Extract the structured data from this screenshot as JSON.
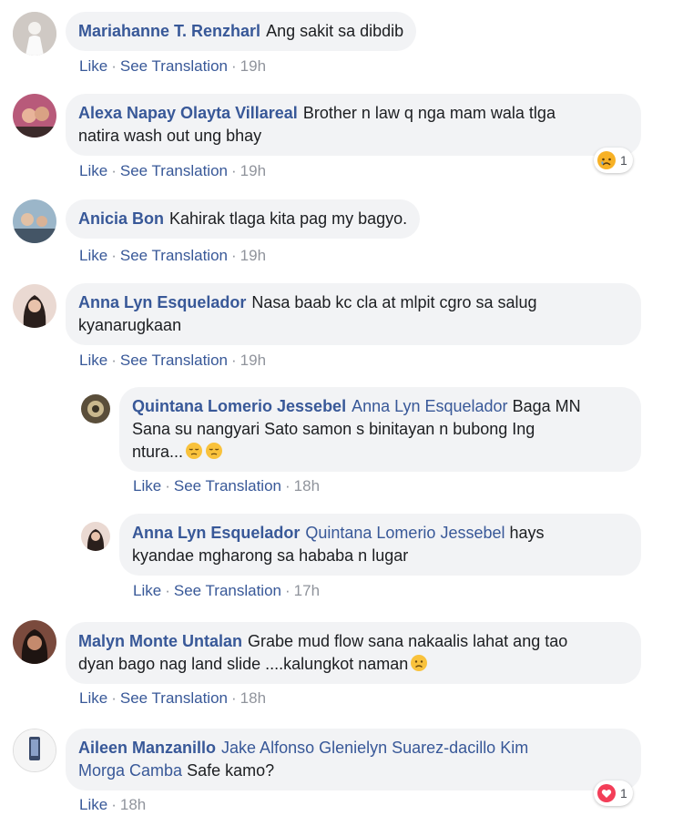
{
  "comments": [
    {
      "name": "Mariahanne T. Renzharl",
      "text": "Ang sakit sa dibdib",
      "like": "Like",
      "translate": "See Translation",
      "time": "19h"
    },
    {
      "name": "Alexa Napay Olayta Villareal",
      "text_line1": "Brother n law q nga mam wala tlga",
      "text_line2": "natira wash out ung bhay",
      "like": "Like",
      "translate": "See Translation",
      "time": "19h",
      "reaction_count": "1",
      "reaction_icon": "sad-face-icon"
    },
    {
      "name": "Anicia Bon",
      "text": "Kahirak tlaga kita pag my bagyo.",
      "like": "Like",
      "translate": "See Translation",
      "time": "19h"
    },
    {
      "name": "Anna Lyn Esquelador",
      "text_line1": "Nasa baab kc cla at mlpit cgro sa salug",
      "text_line2": "kyanarugkaan",
      "like": "Like",
      "translate": "See Translation",
      "time": "19h"
    },
    {
      "name": "Quintana Lomerio Jessebel",
      "mention": "Anna Lyn Esquelador",
      "text_line1_rest": "Baga MN",
      "text_line2": "Sana su nangyari Sato samon s binitayan n bubong Ing",
      "text_line3": "ntura...",
      "like": "Like",
      "translate": "See Translation",
      "time": "18h"
    },
    {
      "name": "Anna Lyn Esquelador",
      "mention": "Quintana Lomerio Jessebel",
      "text_line1_rest": "hays",
      "text_line2": "kyandae mgharong sa hababa n lugar",
      "like": "Like",
      "translate": "See Translation",
      "time": "17h"
    },
    {
      "name": "Malyn Monte Untalan",
      "text_line1": "Grabe mud flow sana nakaalis lahat ang tao",
      "text_line2": "dyan bago nag land slide ....kalungkot naman",
      "like": "Like",
      "translate": "See Translation",
      "time": "18h"
    },
    {
      "name": "Aileen Manzanillo",
      "mention_line1": "Jake Alfonso Glenielyn Suarez-dacillo Kim",
      "mention_line2": "Morga Camba",
      "text_line2_rest": "Safe kamo?",
      "like": "Like",
      "time": "18h",
      "reaction_count": "1",
      "reaction_icon": "heart-icon"
    }
  ],
  "colors": {
    "link": "#385898",
    "bubble": "#f2f3f5",
    "meta": "#90949c"
  }
}
